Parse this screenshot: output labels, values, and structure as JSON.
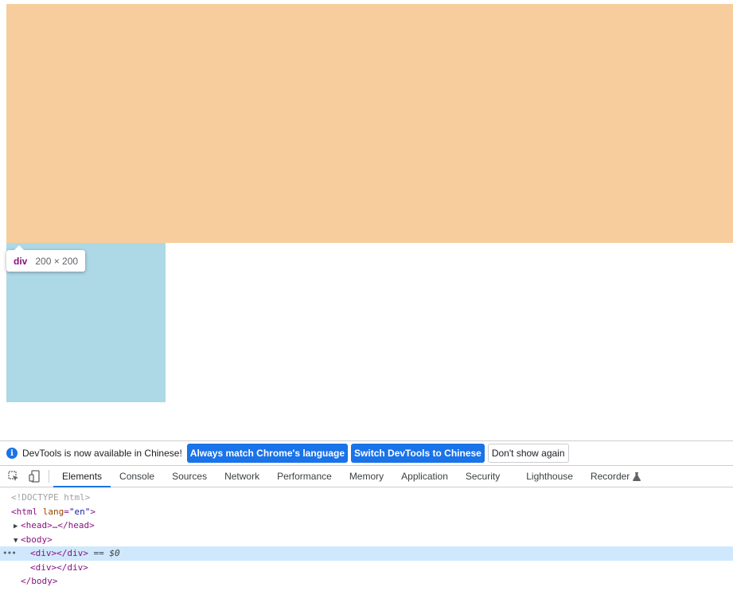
{
  "page": {
    "colors": {
      "blue_box": "#a0b0da",
      "margin_highlight": "#f7cd9e",
      "light_blue_box": "#add8e6"
    },
    "tooltip": {
      "tag": "div",
      "size": "200 × 200"
    }
  },
  "devtools": {
    "infobar": {
      "icon": "info-icon",
      "text": "DevTools is now available in Chinese!",
      "btn_match": "Always match Chrome's language",
      "btn_switch": "Switch DevTools to Chinese",
      "btn_dismiss": "Don't show again"
    },
    "toolbar": {
      "inspect_icon": "inspect-element-icon",
      "device_icon": "device-toolbar-icon"
    },
    "tabs": [
      {
        "label": "Elements",
        "active": true
      },
      {
        "label": "Console"
      },
      {
        "label": "Sources"
      },
      {
        "label": "Network"
      },
      {
        "label": "Performance"
      },
      {
        "label": "Memory"
      },
      {
        "label": "Application"
      },
      {
        "label": "Security"
      },
      {
        "label": "Lighthouse"
      },
      {
        "label": "Recorder",
        "icon": "flask-icon"
      }
    ],
    "dom": {
      "doctype": "<!DOCTYPE html>",
      "html_open": "<html",
      "html_attr_name": "lang",
      "html_attr_value": "\"en\"",
      "html_close_bracket": ">",
      "head": "<head>…</head>",
      "body_open": "<body>",
      "div1": "<div></div>",
      "div1_suffix": " == $0",
      "div2": "<div></div>",
      "body_close": "</body>",
      "more_icon": "more-dots-icon"
    }
  }
}
